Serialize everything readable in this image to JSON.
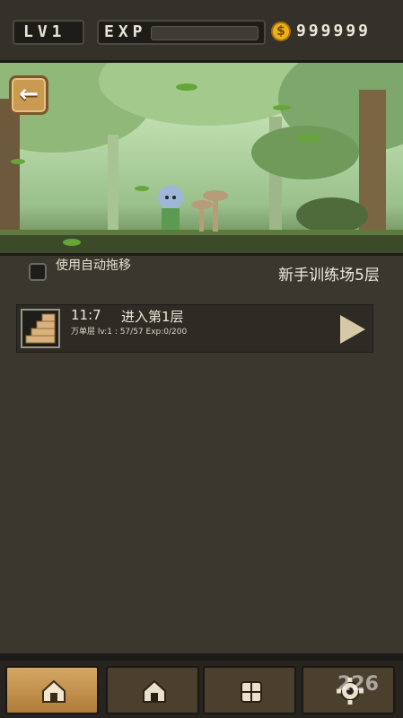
{
  "hud": {
    "level_text": "LV1",
    "exp_label": "EXP",
    "exp_fill": 0.0,
    "coins": "999999",
    "coin_symbol": "$"
  },
  "scene": {
    "back_arrow": "left-arrow-icon"
  },
  "dungeon": {
    "auto_move_label": "使用自动拖移",
    "auto_move_checked": false,
    "stage_title": "新手训练场5层",
    "rows": [
      {
        "time": "11:7",
        "action": "进入第1层",
        "stats": "万单层 lv:1 : 57/57 Exp:0/200",
        "icon": "stairs-icon"
      }
    ]
  },
  "nav": {
    "tabs": [
      {
        "icon": "house-icon",
        "active": true
      },
      {
        "icon": "house-icon",
        "active": false
      },
      {
        "icon": "inventory-icon",
        "active": false
      },
      {
        "icon": "gear-icon",
        "active": false
      }
    ]
  },
  "watermark": "226"
}
